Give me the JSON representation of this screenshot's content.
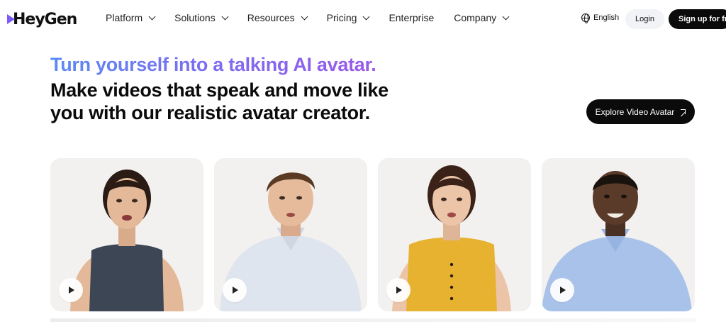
{
  "brand": {
    "logo_text": "HeyGen",
    "accent": "#7b5cf6"
  },
  "nav": {
    "items": [
      {
        "label": "Platform",
        "has_menu": true
      },
      {
        "label": "Solutions",
        "has_menu": true
      },
      {
        "label": "Resources",
        "has_menu": true
      },
      {
        "label": "Pricing",
        "has_menu": true
      },
      {
        "label": "Enterprise",
        "has_menu": false
      },
      {
        "label": "Company",
        "has_menu": true
      }
    ]
  },
  "header_actions": {
    "language": "English",
    "login": "Login",
    "signup": "Sign up for free"
  },
  "hero": {
    "tagline": "Turn yourself into a talking AI avatar.",
    "title": "Make videos that speak and move like you with our realistic avatar creator.",
    "cta": "Explore Video Avatar"
  },
  "avatars": [
    {
      "name": "avatar-woman-navy-top",
      "shirt": "#3c4654",
      "skin": "#e3b99a",
      "hair": "#2a1c14"
    },
    {
      "name": "avatar-man-light-shirt",
      "shirt": "#dfe5ee",
      "skin": "#e5bb9c",
      "hair": "#5a3a22"
    },
    {
      "name": "avatar-woman-yellow-top",
      "shirt": "#e6b230",
      "skin": "#ecc5a8",
      "hair": "#3a2218"
    },
    {
      "name": "avatar-man-blue-shirt",
      "shirt": "#a9c2ea",
      "skin": "#5a3b2a",
      "hair": "#1a120c"
    }
  ]
}
